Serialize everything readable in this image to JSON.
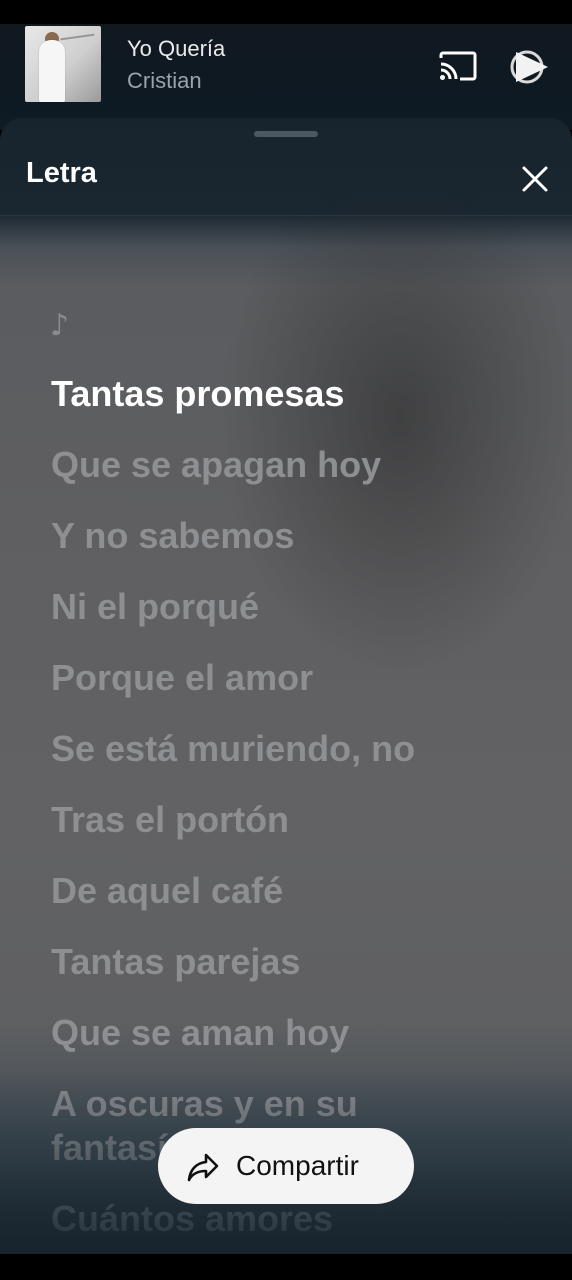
{
  "mini_player": {
    "title": "Yo Quería",
    "artist": "Cristian",
    "cast_icon": "cast-icon",
    "play_icon": "play-pause-icon"
  },
  "lyrics_sheet": {
    "title": "Letra",
    "close_icon": "close-icon",
    "note_symbol": "♪",
    "lines": [
      "Tantas promesas",
      "Que se apagan hoy",
      "Y no sabemos",
      "Ni el porqué",
      "Porque el amor",
      "Se está muriendo, no",
      "Tras el portón",
      "De aquel café",
      "Tantas parejas",
      "Que se aman hoy",
      "A oscuras y en su",
      "fantasía",
      "Cuántos amores"
    ],
    "active_line_index": 0,
    "share_label": "Compartir",
    "share_icon": "share-arrow-icon"
  },
  "colors": {
    "active_lyric": "#ffffff",
    "inactive_lyric": "#8d8f92",
    "share_button_bg": "#f4f4f4"
  }
}
